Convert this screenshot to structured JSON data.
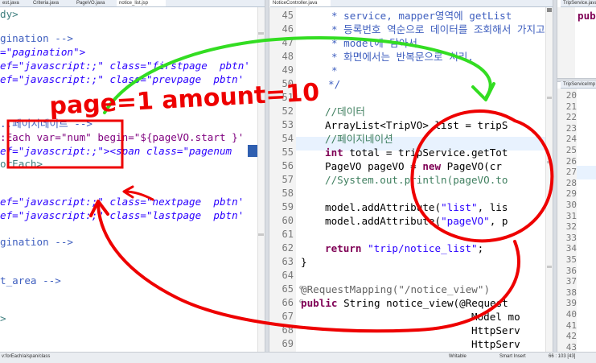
{
  "tabs": [
    {
      "label": "est.java",
      "active": false
    },
    {
      "label": "Criteria.java",
      "active": false
    },
    {
      "label": "PageVO.java",
      "active": false
    },
    {
      "label": "notice_list.jsp",
      "active": true
    },
    {
      "label": "NoticeController.java",
      "active": true
    },
    {
      "label": "TripService.java",
      "active": false
    },
    {
      "label": "TripServiceImp",
      "active": false
    }
  ],
  "left_editor": {
    "lines": [
      "dy>",
      "",
      "gination -->",
      "=\"pagination\">",
      "ef=\"javascript:;\" class=\"firstpage  pbtn'",
      "ef=\"javascript:;\" class=\"prevpage  pbtn'",
      "",
      "..페이지네이트 -->",
      ":Each var=\"num\" begin=\"${pageVO.start }'",
      "ef=\"javascript:;\"><span class=\"pagenum",
      "orEach>",
      "",
      "",
      "ef=\"javascript:;\" class=\"nextpage  pbtn'",
      "ef=\"javascript:;\" class=\"lastpage  pbtn'",
      "",
      "gination -->",
      "",
      "",
      "t_area -->",
      "",
      "",
      ">"
    ]
  },
  "right_editor": {
    "line_numbers": [
      "45",
      "46",
      "47",
      "48",
      "49",
      "50",
      "51",
      "52",
      "53",
      "54",
      "55",
      "56",
      "57",
      "58",
      "59",
      "60",
      "61",
      "62",
      "63",
      "64",
      "65",
      "66",
      "67",
      "68",
      "69"
    ],
    "lines": {
      "45": "* service, mapper영역에 getList",
      "46": "* 등록번호 역순으로 데이터를 조회해서 가지고",
      "47": "* model에 담아서",
      "48": "* 화면에서는 반복문으로 처리.",
      "49": "*",
      "50": "*/",
      "52": "//데이터",
      "53": "ArrayList<TripVO> list = tripS",
      "54": "//페이지네이션",
      "55": "int total = tripService.getTot",
      "56": "PageVO pageVO = new PageVO(cr",
      "57": "//System.out.println(pageVO.to",
      "59": "model.addAttribute(\"list\", lis",
      "60": "model.addAttribute(\"pageVO\", p",
      "62": "return \"trip/notice_list\";",
      "63": "}",
      "65": "@RequestMapping(\"/notice_view\")",
      "66": "public String notice_view(@Request",
      "67": "Model mo",
      "68": "HttpServ",
      "69": "HttpServ"
    }
  },
  "far_right": {
    "top_text": "pub",
    "line_numbers": [
      "20",
      "21",
      "22",
      "23",
      "24",
      "25",
      "26",
      "27",
      "28",
      "29",
      "30",
      "31",
      "32",
      "33",
      "34",
      "35",
      "36",
      "37",
      "38",
      "39",
      "40",
      "41",
      "42",
      "43"
    ]
  },
  "status_bar": {
    "path": "v:forEach/a/span/class",
    "writable": "Writable",
    "insert_mode": "Smart Insert",
    "position": "66 : 103 [43]"
  },
  "annotations": {
    "handwriting": "page=1   amount=10"
  }
}
